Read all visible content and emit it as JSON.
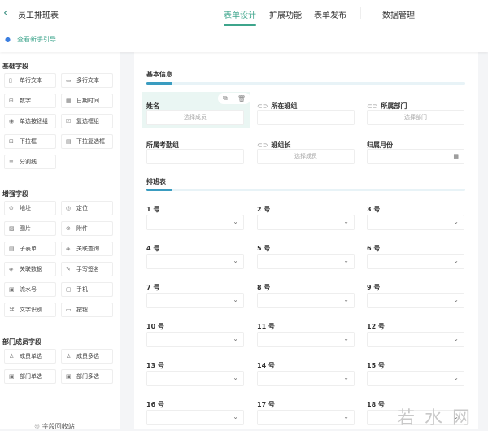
{
  "header": {
    "title": "员工排班表",
    "tabs": [
      "表单设计",
      "扩展功能",
      "表单发布",
      "数据管理"
    ],
    "active_tab": 0,
    "guide_link": "查看新手引导"
  },
  "sidebar": {
    "sections": [
      {
        "title": "基础字段",
        "items": [
          {
            "icon": "text-icon",
            "glyph": "▯",
            "label": "单行文本"
          },
          {
            "icon": "multiline-icon",
            "glyph": "▭",
            "label": "多行文本"
          },
          {
            "icon": "number-icon",
            "glyph": "⊟",
            "label": "数字"
          },
          {
            "icon": "calendar-icon",
            "glyph": "▦",
            "label": "日期时间"
          },
          {
            "icon": "radio-icon",
            "glyph": "◉",
            "label": "单选按钮组"
          },
          {
            "icon": "checkbox-icon",
            "glyph": "☑",
            "label": "复选框组"
          },
          {
            "icon": "dropdown-icon",
            "glyph": "⊟",
            "label": "下拉框"
          },
          {
            "icon": "multi-dropdown-icon",
            "glyph": "▤",
            "label": "下拉复选框"
          },
          {
            "icon": "divider-icon",
            "glyph": "≡",
            "label": "分割线"
          }
        ]
      },
      {
        "title": "增强字段",
        "items": [
          {
            "icon": "location-icon",
            "glyph": "⊙",
            "label": "地址"
          },
          {
            "icon": "locate-icon",
            "glyph": "◎",
            "label": "定位"
          },
          {
            "icon": "image-icon",
            "glyph": "▨",
            "label": "图片"
          },
          {
            "icon": "attachment-icon",
            "glyph": "⊘",
            "label": "附件"
          },
          {
            "icon": "subform-icon",
            "glyph": "▤",
            "label": "子表单"
          },
          {
            "icon": "link-query-icon",
            "glyph": "◈",
            "label": "关联查询"
          },
          {
            "icon": "link-data-icon",
            "glyph": "◈",
            "label": "关联数据"
          },
          {
            "icon": "signature-icon",
            "glyph": "✎",
            "label": "手写签名"
          },
          {
            "icon": "serial-icon",
            "glyph": "▣",
            "label": "流水号"
          },
          {
            "icon": "phone-icon",
            "glyph": "▢",
            "label": "手机"
          },
          {
            "icon": "ocr-icon",
            "glyph": "⌘",
            "label": "文字识别"
          },
          {
            "icon": "button-icon",
            "glyph": "▭",
            "label": "按钮"
          }
        ]
      },
      {
        "title": "部门成员字段",
        "items": [
          {
            "icon": "user-icon",
            "glyph": "♙",
            "label": "成员单选"
          },
          {
            "icon": "users-icon",
            "glyph": "♙",
            "label": "成员多选"
          },
          {
            "icon": "dept-icon",
            "glyph": "▣",
            "label": "部门单选"
          },
          {
            "icon": "depts-icon",
            "glyph": "▣",
            "label": "部门多选"
          }
        ]
      }
    ],
    "trash_label": "字段回收站"
  },
  "form": {
    "basic_title": "基本信息",
    "fields": [
      {
        "label": "姓名",
        "linked": false,
        "placeholder": "选择成员"
      },
      {
        "label": "所在班组",
        "linked": true,
        "placeholder": ""
      },
      {
        "label": "所属部门",
        "linked": true,
        "placeholder": "选择部门"
      },
      {
        "label": "所属考勤组",
        "linked": false,
        "placeholder": ""
      },
      {
        "label": "班组长",
        "linked": true,
        "placeholder": "选择成员"
      },
      {
        "label": "归属月份",
        "linked": false,
        "placeholder": "",
        "calendar": true
      }
    ],
    "schedule_title": "排班表",
    "days": [
      "1 号",
      "2 号",
      "3 号",
      "4 号",
      "5 号",
      "6 号",
      "7 号",
      "8 号",
      "9 号",
      "10 号",
      "11 号",
      "12 号",
      "13 号",
      "14 号",
      "15 号",
      "16 号",
      "17 号",
      "18 号"
    ]
  },
  "watermark": "若水网"
}
